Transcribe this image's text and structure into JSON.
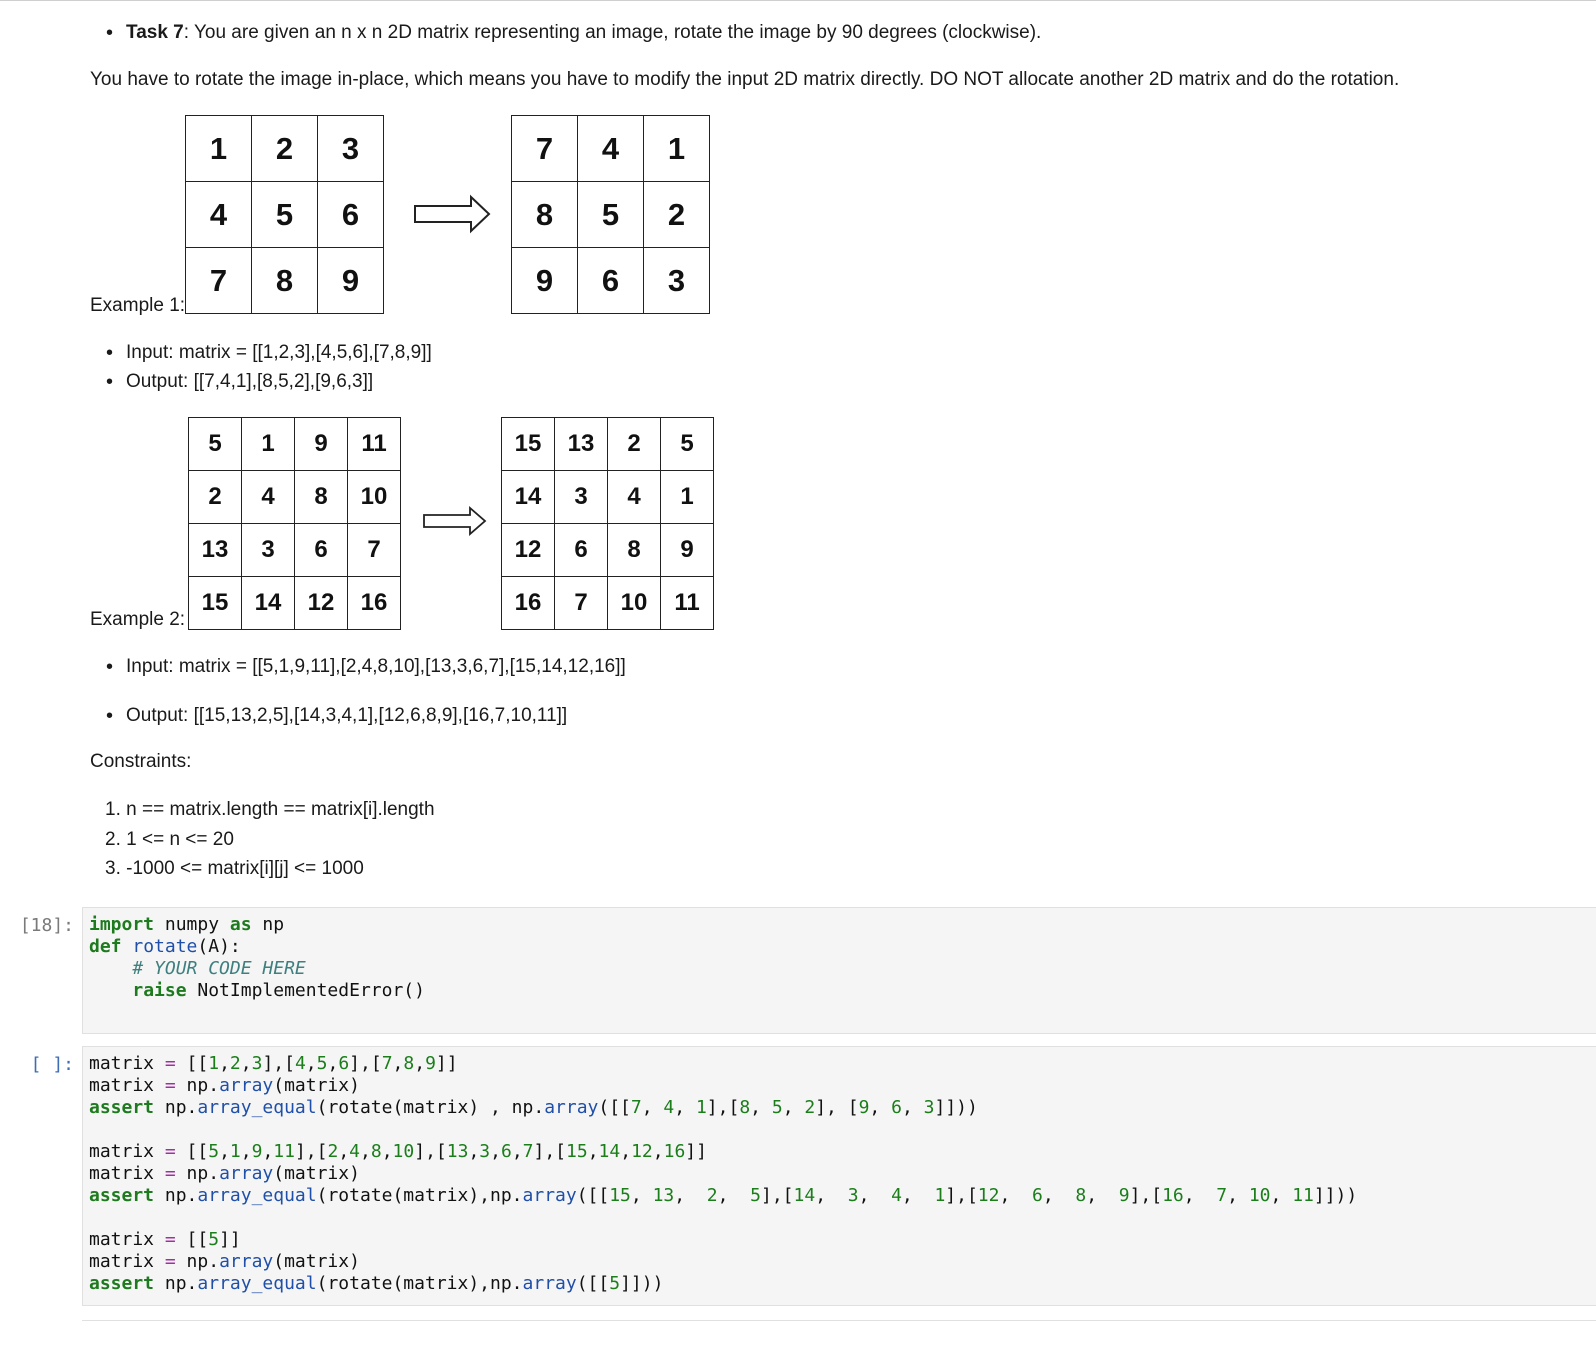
{
  "task": {
    "label": "Task 7",
    "text": ": You are given an n x n 2D matrix representing an image, rotate the image by 90 degrees (clockwise)."
  },
  "description": "You have to rotate the image in-place, which means you have to modify the input 2D matrix directly. DO NOT allocate another 2D matrix and do the rotation.",
  "example1": {
    "label": "Example 1:",
    "input_grid": [
      [
        "1",
        "2",
        "3"
      ],
      [
        "4",
        "5",
        "6"
      ],
      [
        "7",
        "8",
        "9"
      ]
    ],
    "output_grid": [
      [
        "7",
        "4",
        "1"
      ],
      [
        "8",
        "5",
        "2"
      ],
      [
        "9",
        "6",
        "3"
      ]
    ],
    "input_text": "Input: matrix = [[1,2,3],[4,5,6],[7,8,9]]",
    "output_text": "Output: [[7,4,1],[8,5,2],[9,6,3]]"
  },
  "example2": {
    "label": "Example 2:",
    "input_grid": [
      [
        "5",
        "1",
        "9",
        "11"
      ],
      [
        "2",
        "4",
        "8",
        "10"
      ],
      [
        "13",
        "3",
        "6",
        "7"
      ],
      [
        "15",
        "14",
        "12",
        "16"
      ]
    ],
    "output_grid": [
      [
        "15",
        "13",
        "2",
        "5"
      ],
      [
        "14",
        "3",
        "4",
        "1"
      ],
      [
        "12",
        "6",
        "8",
        "9"
      ],
      [
        "16",
        "7",
        "10",
        "11"
      ]
    ],
    "input_text": "Input: matrix = [[5,1,9,11],[2,4,8,10],[13,3,6,7],[15,14,12,16]]",
    "output_text": "Output: [[15,13,2,5],[14,3,4,1],[12,6,8,9],[16,7,10,11]]"
  },
  "constraints": {
    "title": "Constraints:",
    "items": [
      {
        "num": "1.",
        "text": "n == matrix.length == matrix[i].length"
      },
      {
        "num": "2.",
        "text": "1 <= n <= 20"
      },
      {
        "num": "3.",
        "text": "-1000 <= matrix[i][j] <= 1000"
      }
    ]
  },
  "cells": [
    {
      "prompt": "[18]:"
    },
    {
      "prompt": "[ ]:"
    }
  ]
}
